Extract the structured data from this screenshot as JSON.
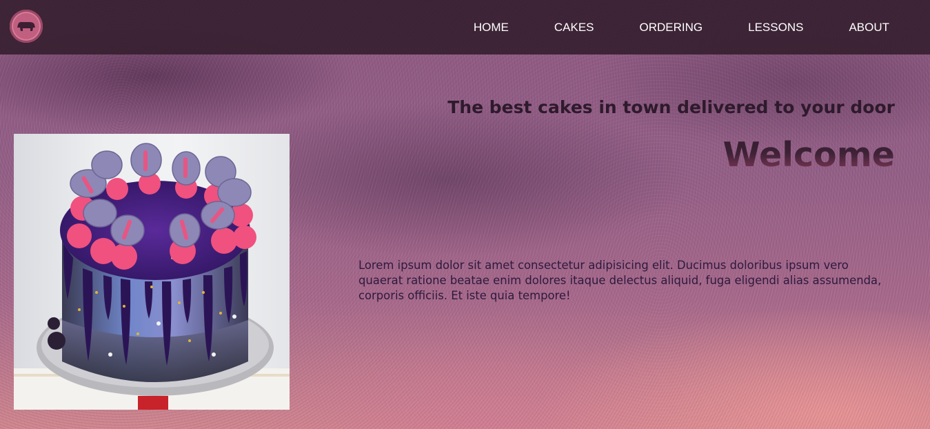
{
  "nav": {
    "logo": "bakery-logo",
    "items": [
      {
        "label": "HOME"
      },
      {
        "label": "CAKES"
      },
      {
        "label": "ORDERING"
      },
      {
        "label": "LESSONS"
      },
      {
        "label": "ABOUT"
      }
    ]
  },
  "hero": {
    "tagline": "The best cakes in town delivered to your door",
    "heading": "Welcome",
    "description": "Lorem ipsum dolor sit amet consectetur adipisicing elit. Ducimus doloribus ipsum vero quaerat ratione beatae enim dolores itaque delectus aliquid, fuga eligendi alias assumenda, corporis officiis. Et iste quia tempore!"
  },
  "image": {
    "subject": "drip cake with macarons"
  },
  "colors": {
    "navbar": "#372030",
    "nav_text": "#ffffff",
    "heading": "#2e1a2c",
    "body_text": "#2d1a3d",
    "accent_pink": "#f0517f"
  }
}
